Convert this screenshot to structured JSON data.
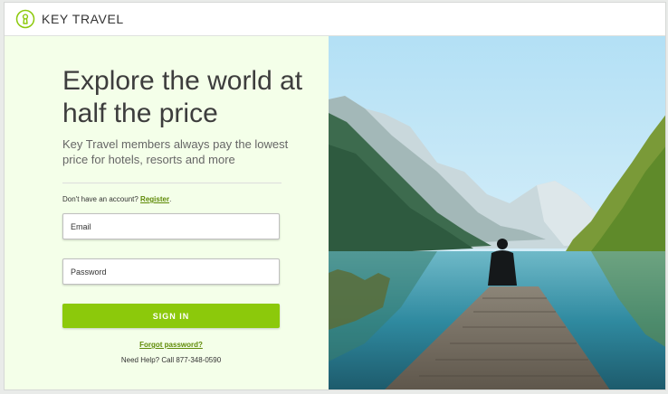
{
  "brand": {
    "name": "KEY TRAVEL"
  },
  "hero": {
    "headline": "Explore the world at half the price",
    "subtext": "Key Travel members always pay the lowest price for hotels, resorts and more"
  },
  "account": {
    "prompt": "Don't have an account?",
    "register_label": "Register",
    "suffix": "."
  },
  "form": {
    "email_placeholder": "Email",
    "password_placeholder": "Password",
    "signin_label": "SIGN IN",
    "forgot_label": "Forgot password?",
    "help_text": "Need Help? Call 877-348-0590"
  },
  "photo": {
    "icon": "lake-landscape-photo"
  },
  "colors": {
    "accent": "#8cc90b",
    "link": "#5f8a07",
    "panel_bg": "#f4ffe9"
  }
}
